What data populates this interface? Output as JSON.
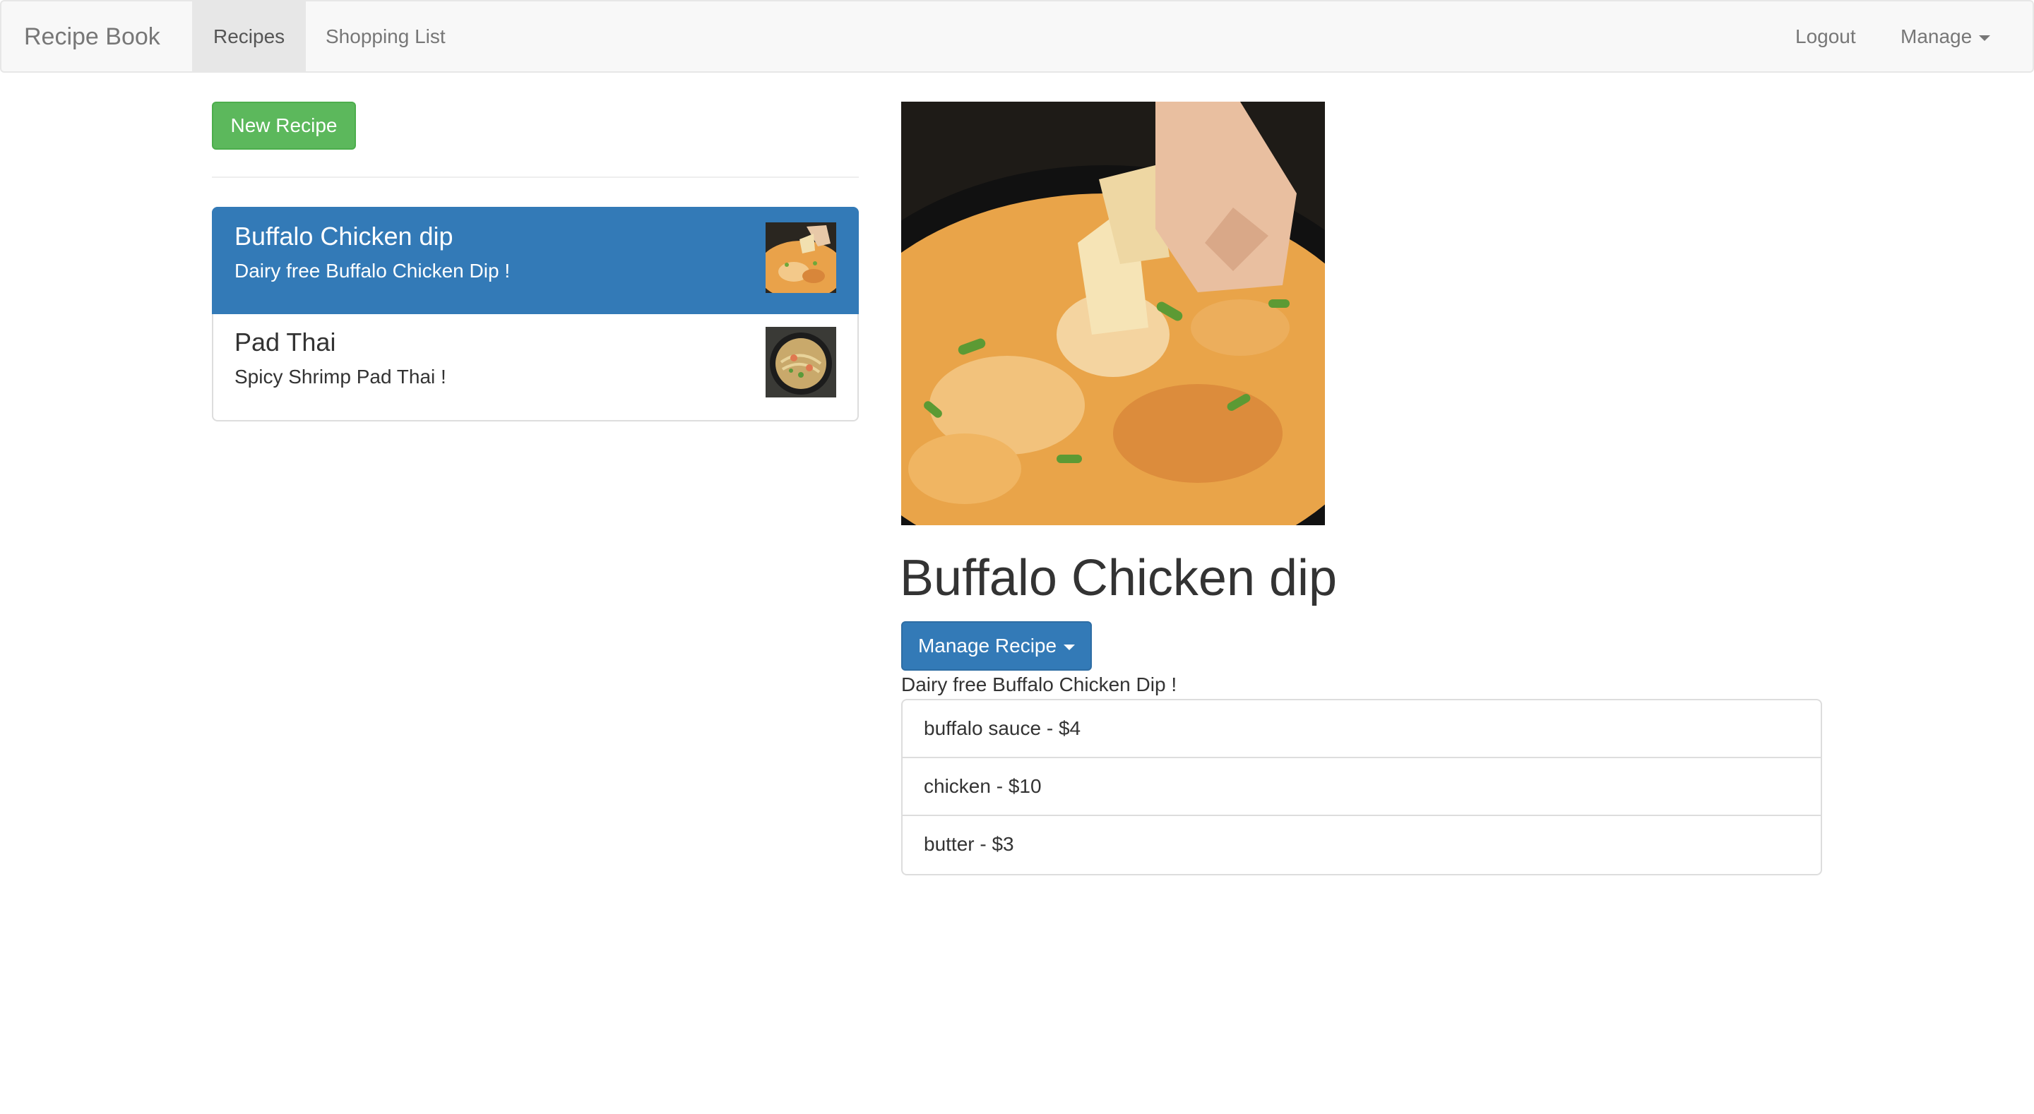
{
  "navbar": {
    "brand": "Recipe Book",
    "links": [
      "Recipes",
      "Shopping List"
    ],
    "logout_label": "Logout",
    "manage_label": "Manage"
  },
  "actions": {
    "new_recipe_label": "New Recipe"
  },
  "recipes": [
    {
      "name": "Buffalo Chicken dip",
      "description": "Dairy free Buffalo Chicken Dip !",
      "active": true
    },
    {
      "name": "Pad Thai",
      "description": "Spicy Shrimp Pad Thai !",
      "active": false
    }
  ],
  "detail": {
    "title": "Buffalo Chicken dip",
    "manage_label": "Manage Recipe",
    "description": "Dairy free Buffalo Chicken Dip !",
    "ingredients": [
      "buffalo sauce - $4",
      "chicken - $10",
      "butter - $3"
    ]
  },
  "colors": {
    "primary": "#337ab7",
    "success": "#5cb85c",
    "navbar_bg": "#f8f8f8"
  }
}
